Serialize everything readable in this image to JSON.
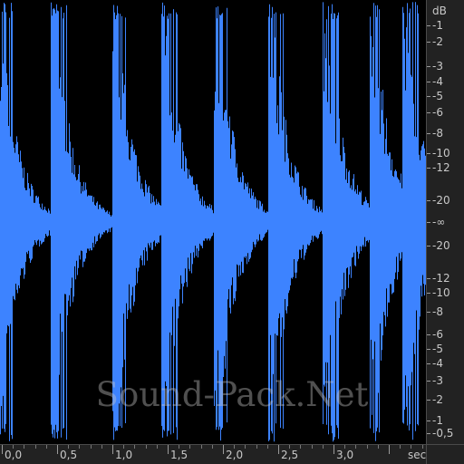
{
  "waveform": {
    "color": "#3d83ff",
    "background": "#000000"
  },
  "watermark": "Sound-Pack.Net",
  "db_ruler": {
    "unit": "dB",
    "labels": [
      "-1",
      "-2",
      "-3",
      "-4",
      "-5",
      "-6",
      "-8",
      "-10",
      "-12",
      "-20",
      "-∞",
      "-20",
      "-12",
      "-10",
      "-8",
      "-6",
      "-5",
      "-4",
      "-3",
      "-2",
      "-1",
      "-0,5"
    ]
  },
  "time_ruler": {
    "unit": "sec",
    "labels": [
      "0,0",
      "0,5",
      "1,0",
      "1,5",
      "2,0",
      "2,5",
      "3,0"
    ]
  }
}
